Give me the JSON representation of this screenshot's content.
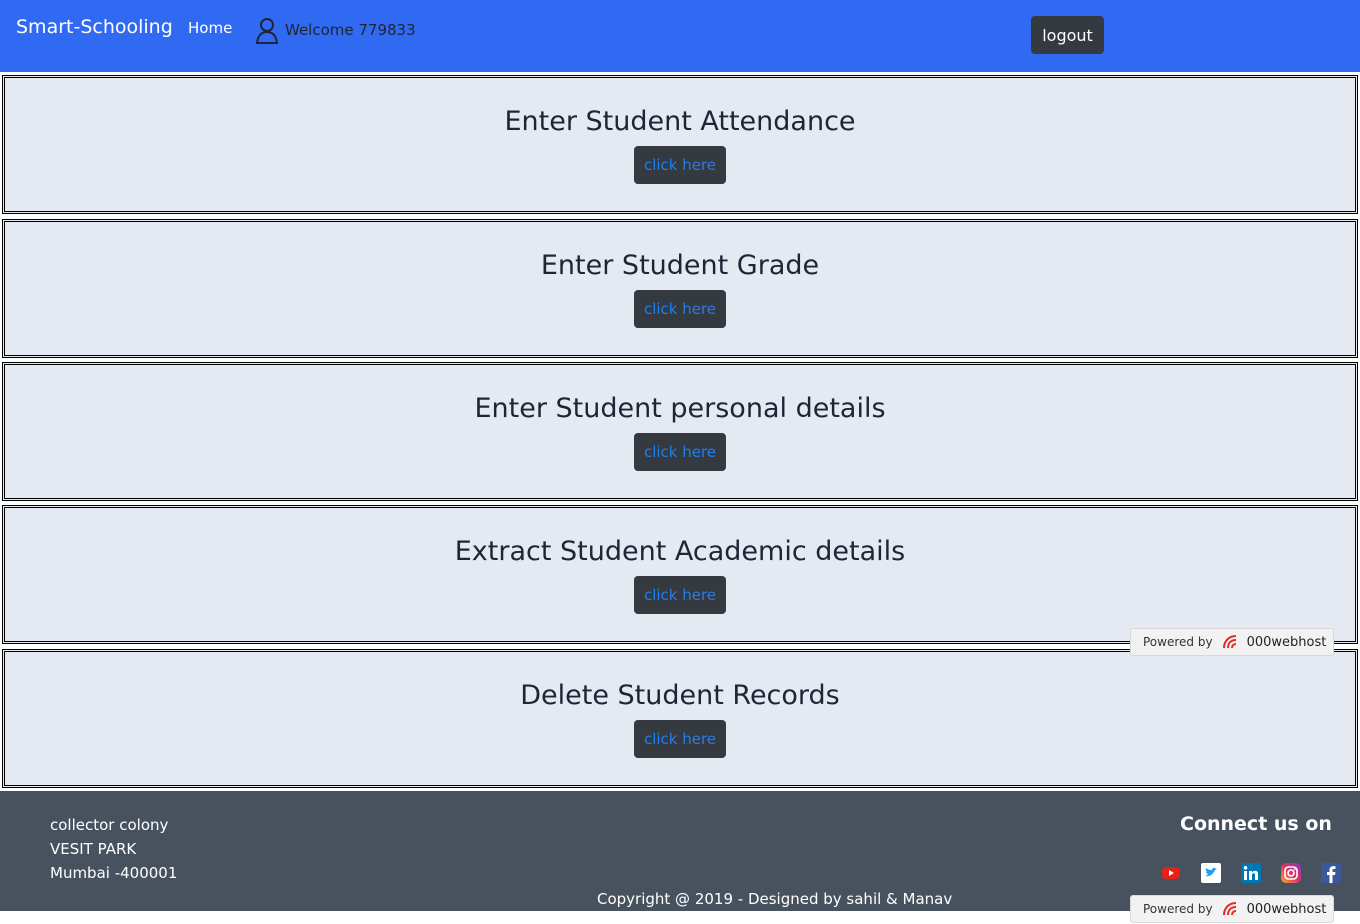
{
  "navbar": {
    "brand": "Smart-Schooling",
    "home_label": "Home",
    "welcome_text": "Welcome 779833",
    "logout_label": "logout",
    "background": "#316af2"
  },
  "panels": [
    {
      "title": "Enter Student Attendance",
      "button_label": "click here"
    },
    {
      "title": "Enter Student Grade",
      "button_label": "click here"
    },
    {
      "title": "Enter Student personal details",
      "button_label": "click here"
    },
    {
      "title": "Extract Student Academic details",
      "button_label": "click here"
    },
    {
      "title": "Delete Student Records",
      "button_label": "click here"
    }
  ],
  "footer": {
    "address_lines": [
      "collector colony",
      "VESIT PARK",
      "Mumbai -400001"
    ],
    "connect_title": "Connect us on",
    "social_icons": [
      "youtube-icon",
      "twitter-icon",
      "linkedin-icon",
      "instagram-icon",
      "facebook-icon"
    ],
    "copyright": "Copyright @ 2019 - Designed by sahil & Manav",
    "background": "#48525f"
  },
  "badge": {
    "powered_by": "Powered by",
    "host_name": "000webhost"
  }
}
